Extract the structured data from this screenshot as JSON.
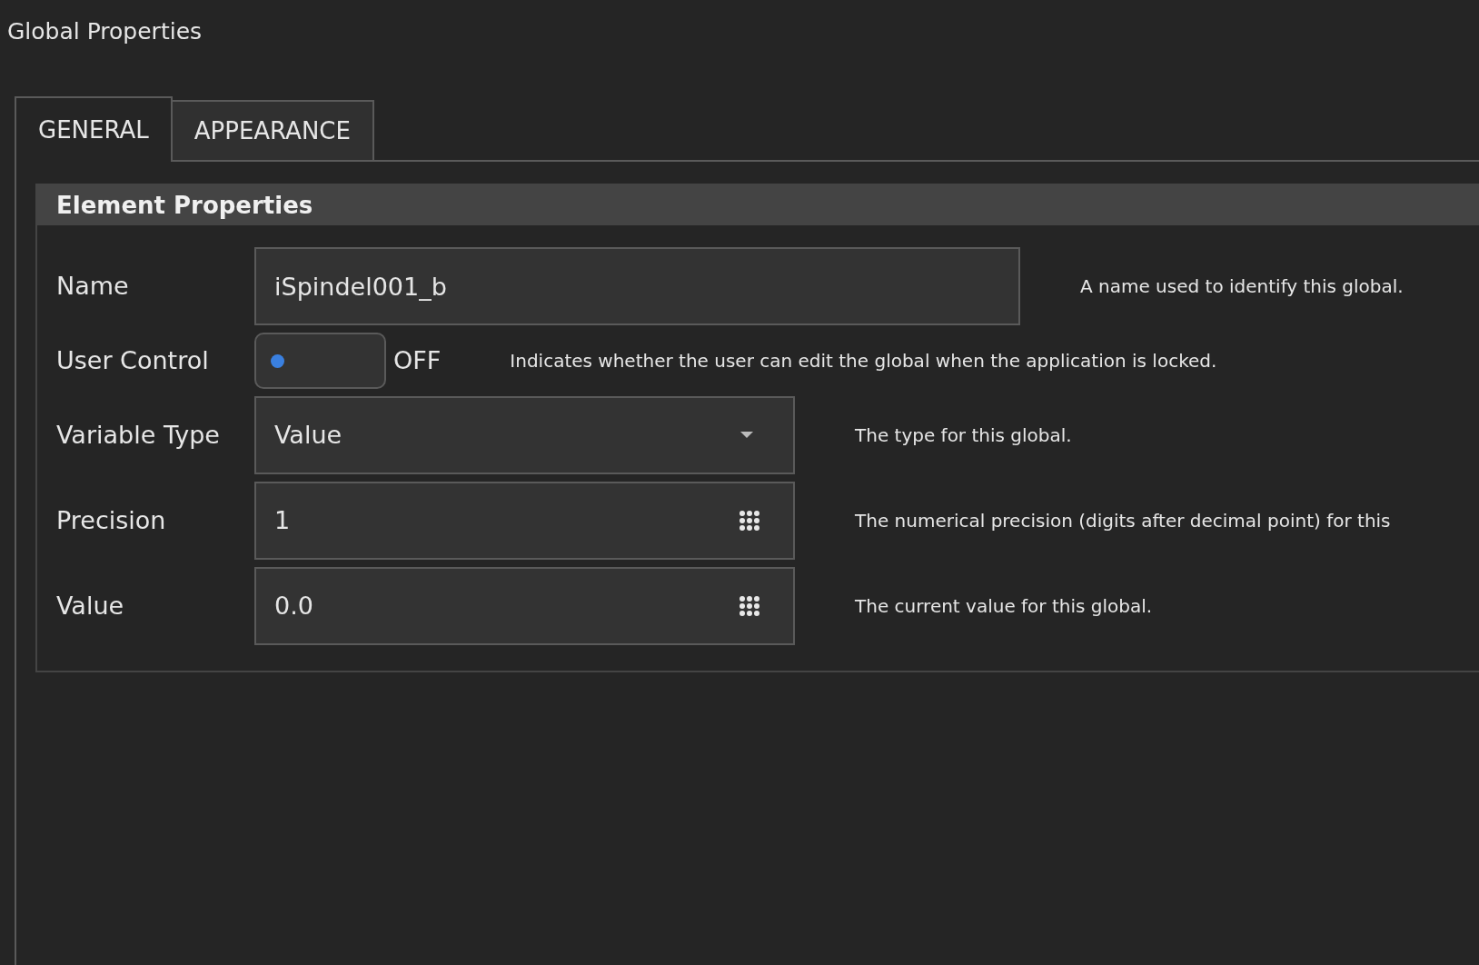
{
  "window": {
    "title": "Global Properties"
  },
  "tabs": [
    {
      "label": "GENERAL",
      "selected": true
    },
    {
      "label": "APPEARANCE",
      "selected": false
    }
  ],
  "group": {
    "title": "Element Properties",
    "rows": [
      {
        "kind": "text",
        "label": "Name",
        "value": "iSpindel001_b",
        "description": "A name used to identify this global."
      },
      {
        "kind": "toggle",
        "label": "User Control",
        "on": false,
        "state_label": "OFF",
        "description": "Indicates whether the user can edit the global when the application is locked."
      },
      {
        "kind": "select",
        "label": "Variable Type",
        "value": "Value",
        "description": "The type for this global."
      },
      {
        "kind": "numeric",
        "label": "Precision",
        "value": "1",
        "description": "The numerical precision (digits after decimal point) for this"
      },
      {
        "kind": "numeric",
        "label": "Value",
        "value": "0.0",
        "description": "The current value for this global."
      }
    ]
  }
}
